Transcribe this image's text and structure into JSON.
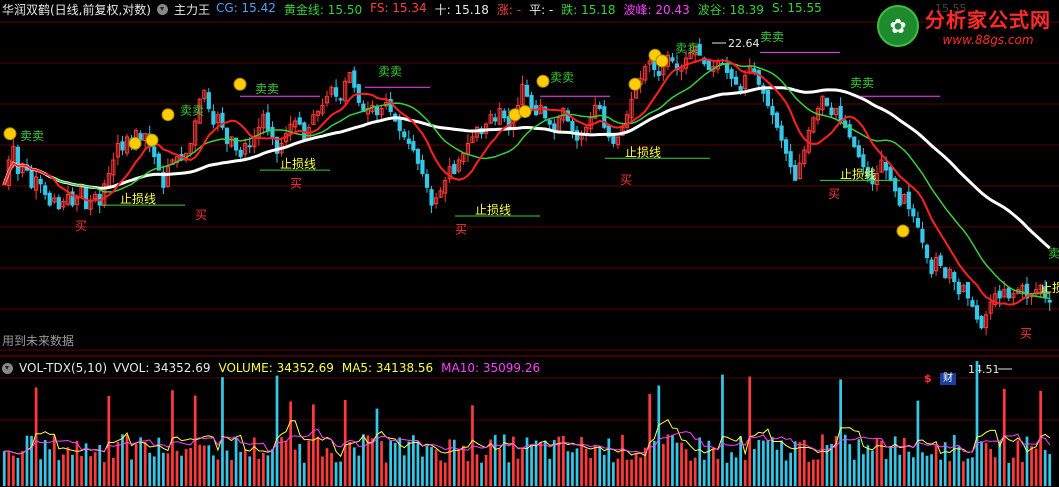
{
  "header": {
    "stock_name": "华润双鹤(日线,前复权,对数)",
    "indicator_name": "主力王",
    "items": [
      {
        "label": "CG: 15.42",
        "color": "#4fa0ff"
      },
      {
        "label": "黄金线: 15.50",
        "color": "#39d039"
      },
      {
        "label": "FS: 15.34",
        "color": "#ff4040"
      },
      {
        "label": "十: 15.18",
        "color": "#e8e8e8"
      },
      {
        "label": "涨: -",
        "color": "#ff4040"
      },
      {
        "label": "平: -",
        "color": "#e8e8e8"
      },
      {
        "label": "跌: 15.18",
        "color": "#39d039"
      },
      {
        "label": "波峰: 20.43",
        "color": "#ff40ff"
      },
      {
        "label": "波谷: 18.39",
        "color": "#39d039"
      },
      {
        "label": "S: 15.55",
        "color": "#39d039"
      }
    ]
  },
  "watermark": {
    "icon_text": "✿",
    "title": "分析家公式网",
    "url": "www.88gs.com"
  },
  "top_faded_text": "15.55",
  "future_data_note": "用到未来数据",
  "volume_header": {
    "name": "VOL-TDX(5,10)",
    "items": [
      {
        "label": "VVOL: 34352.69",
        "color": "#e8e8e8"
      },
      {
        "label": "VOLUME: 34352.69",
        "color": "#ffff40"
      },
      {
        "label": "MA5: 34138.56",
        "color": "#ffff40"
      },
      {
        "label": "MA10: 35099.26",
        "color": "#ff40ff"
      }
    ]
  },
  "badges": {
    "dollar": "$",
    "fin": "财"
  },
  "labels": {
    "buy": "买",
    "sell": "卖",
    "sell_sell": "卖卖",
    "stop_loss": "止损线"
  },
  "chart_data": {
    "type": "candlestick",
    "price_high_label": "22.64",
    "price_low_label": "14.51",
    "ylim": [
      14.0,
      23.5
    ],
    "grid": true,
    "closes": [
      18.2,
      18.9,
      19.3,
      18.5,
      18.8,
      18.6,
      18.1,
      18.4,
      18.2,
      17.9,
      17.6,
      17.8,
      17.5,
      17.7,
      17.9,
      17.6,
      17.8,
      18.1,
      17.5,
      17.7,
      17.9,
      17.6,
      18.2,
      18.5,
      18.9,
      19.4,
      19.2,
      19.6,
      19.4,
      19.8,
      19.5,
      19.7,
      19.3,
      19.0,
      18.6,
      18.1,
      18.7,
      18.9,
      19.0,
      18.9,
      19.1,
      19.4,
      20.1,
      20.8,
      21.1,
      20.5,
      20.0,
      20.3,
      19.9,
      19.4,
      19.6,
      19.2,
      19.0,
      19.4,
      19.3,
      19.6,
      19.9,
      20.3,
      19.8,
      19.6,
      19.1,
      19.4,
      19.7,
      20.0,
      20.1,
      20.0,
      19.5,
      19.9,
      20.3,
      20.4,
      20.6,
      20.9,
      21.2,
      20.9,
      20.8,
      21.4,
      21.7,
      21.2,
      20.7,
      20.4,
      20.5,
      20.6,
      20.3,
      20.5,
      20.7,
      20.4,
      20.1,
      19.8,
      19.6,
      19.4,
      19.2,
      18.8,
      18.5,
      18.1,
      17.6,
      17.8,
      18.0,
      18.3,
      18.7,
      18.5,
      18.9,
      19.1,
      19.4,
      19.6,
      19.9,
      19.7,
      20.0,
      20.3,
      20.1,
      20.5,
      20.2,
      19.9,
      20.3,
      20.6,
      21.3,
      20.9,
      20.5,
      20.3,
      20.6,
      20.2,
      20.0,
      19.8,
      20.2,
      20.5,
      20.1,
      19.8,
      19.5,
      19.7,
      19.9,
      20.2,
      20.6,
      20.5,
      19.9,
      19.6,
      19.4,
      19.6,
      19.9,
      20.3,
      20.8,
      21.2,
      21.5,
      21.9,
      22.1,
      21.8,
      21.6,
      22.0,
      22.3,
      22.1,
      21.8,
      21.9,
      22.2,
      22.4,
      22.6,
      22.3,
      22.0,
      21.8,
      21.9,
      22.1,
      22.0,
      21.7,
      21.5,
      21.3,
      21.1,
      21.6,
      21.9,
      21.7,
      21.3,
      21.0,
      20.6,
      20.3,
      19.9,
      19.5,
      19.1,
      18.7,
      18.3,
      18.8,
      19.2,
      19.8,
      20.2,
      20.5,
      20.9,
      20.6,
      20.3,
      20.5,
      20.1,
      19.9,
      19.6,
      19.3,
      19.0,
      18.7,
      18.4,
      18.2,
      18.5,
      18.9,
      18.6,
      18.3,
      18.0,
      17.6,
      17.9,
      17.5,
      17.3,
      17.0,
      16.6,
      16.2,
      15.8,
      16.2,
      16.0,
      15.7,
      15.9,
      15.6,
      15.3,
      15.5,
      15.2,
      15.0,
      14.7,
      14.5,
      14.8,
      15.1,
      15.3,
      15.2,
      15.4,
      15.2,
      15.3,
      15.4,
      15.5,
      15.2,
      15.3,
      15.4,
      15.5,
      15.2,
      15.1
    ],
    "volume_max": 90000
  }
}
